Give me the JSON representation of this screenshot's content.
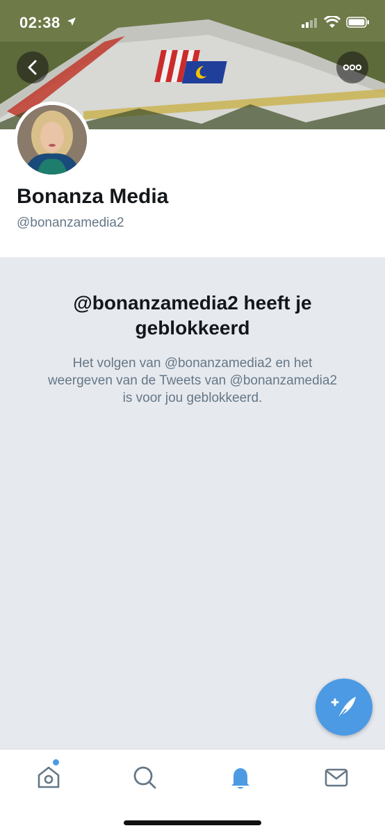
{
  "status_bar": {
    "time": "02:38"
  },
  "profile": {
    "display_name": "Bonanza Media",
    "handle": "@bonanzamedia2"
  },
  "blocked": {
    "title": "@bonanzamedia2 heeft je geblokkeerd",
    "message": "Het volgen van @bonanzamedia2 en het weergeven van de Tweets van @bonanzamedia2 is voor jou geblokkeerd."
  },
  "tabs": [
    {
      "icon": "home-icon"
    },
    {
      "icon": "search-icon"
    },
    {
      "icon": "bell-icon",
      "active": true
    },
    {
      "icon": "mail-icon"
    }
  ],
  "colors": {
    "accent": "#4c9ae3",
    "background": "#e6e9ee",
    "secondary_text": "#657786"
  }
}
